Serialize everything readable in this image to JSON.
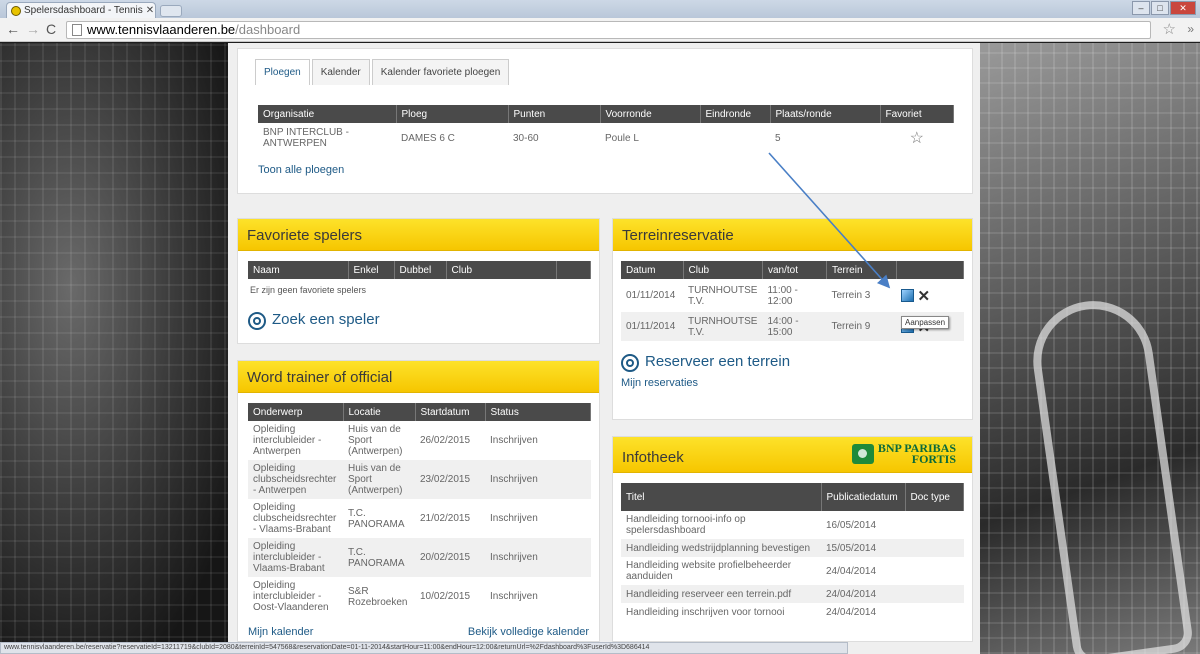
{
  "browser": {
    "tab_title": "Spelersdashboard - Tennis",
    "url_host": "www.tennisvlaanderen.be",
    "url_path": "/dashboard",
    "status_url": "www.tennisvlaanderen.be/reservatie?reservatieId=13211719&clubId=2080&terreinId=547568&reservationDate=01-11-2014&startHour=11:00&endHour=12:00&returnUrl=%2Fdashboard%3FuserId%3D686414"
  },
  "ploegen_panel": {
    "tabs": [
      "Ploegen",
      "Kalender",
      "Kalender favoriete ploegen"
    ],
    "headers": [
      "Organisatie",
      "Ploeg",
      "Punten",
      "Voorronde",
      "Eindronde",
      "Plaats/ronde",
      "Favoriet"
    ],
    "rows": [
      {
        "organisatie": "BNP INTERCLUB - ANTWERPEN",
        "ploeg": "DAMES 6 C",
        "punten": "30-60",
        "voorronde": "Poule L",
        "eindronde": "",
        "plaats": "5"
      }
    ],
    "show_all": "Toon alle ploegen"
  },
  "favoriete_spelers": {
    "title": "Favoriete spelers",
    "headers": [
      "Naam",
      "Enkel",
      "Dubbel",
      "Club",
      ""
    ],
    "empty_text": "Er zijn geen favoriete spelers",
    "search_label": "Zoek een speler"
  },
  "terreinreservatie": {
    "title": "Terreinreservatie",
    "headers": [
      "Datum",
      "Club",
      "van/tot",
      "Terrein",
      ""
    ],
    "rows": [
      {
        "datum": "01/11/2014",
        "club": "TURNHOUTSE T.V.",
        "tijd": "11:00 - 12:00",
        "terrein": "Terrein 3"
      },
      {
        "datum": "01/11/2014",
        "club": "TURNHOUTSE T.V.",
        "tijd": "14:00 - 15:00",
        "terrein": "Terrein 9"
      }
    ],
    "tooltip": "Aanpassen",
    "reserve_label": "Reserveer een terrein",
    "my_reservations": "Mijn reservaties"
  },
  "trainer": {
    "title": "Word trainer of official",
    "headers": [
      "Onderwerp",
      "Locatie",
      "Startdatum",
      "Status"
    ],
    "rows": [
      {
        "onderwerp": "Opleiding interclubleider - Antwerpen",
        "locatie": "Huis van de Sport (Antwerpen)",
        "datum": "26/02/2015",
        "status": "Inschrijven"
      },
      {
        "onderwerp": "Opleiding clubscheidsrechter - Antwerpen",
        "locatie": "Huis van de Sport (Antwerpen)",
        "datum": "23/02/2015",
        "status": "Inschrijven"
      },
      {
        "onderwerp": "Opleiding clubscheidsrechter - Vlaams-Brabant",
        "locatie": "T.C. PANORAMA",
        "datum": "21/02/2015",
        "status": "Inschrijven"
      },
      {
        "onderwerp": "Opleiding interclubleider - Vlaams-Brabant",
        "locatie": "T.C. PANORAMA",
        "datum": "20/02/2015",
        "status": "Inschrijven"
      },
      {
        "onderwerp": "Opleiding interclubleider - Oost-Vlaanderen",
        "locatie": "S&R Rozebroeken",
        "datum": "10/02/2015",
        "status": "Inschrijven"
      }
    ],
    "my_calendar": "Mijn kalender",
    "full_calendar": "Bekijk volledige kalender"
  },
  "infotheek": {
    "title": "Infotheek",
    "sponsor_line1": "BNP PARIBAS",
    "sponsor_line2": "FORTIS",
    "headers": [
      "Titel",
      "Publicatiedatum",
      "Doc type"
    ],
    "rows": [
      {
        "titel": "Handleiding tornooi-info op spelersdashboard",
        "datum": "16/05/2014"
      },
      {
        "titel": "Handleiding wedstrijdplanning bevestigen",
        "datum": "15/05/2014"
      },
      {
        "titel": "Handleiding website profielbeheerder aanduiden",
        "datum": "24/04/2014"
      },
      {
        "titel": "Handleiding reserveer een terrein.pdf",
        "datum": "24/04/2014"
      },
      {
        "titel": "Handleiding inschrijven voor tornooi",
        "datum": "24/04/2014"
      }
    ]
  },
  "colors": {
    "accent_yellow": "#f6c600",
    "link_blue": "#1e5a86",
    "header_dark": "#4a4a4a",
    "annotation_arrow": "#4a7fc6"
  }
}
